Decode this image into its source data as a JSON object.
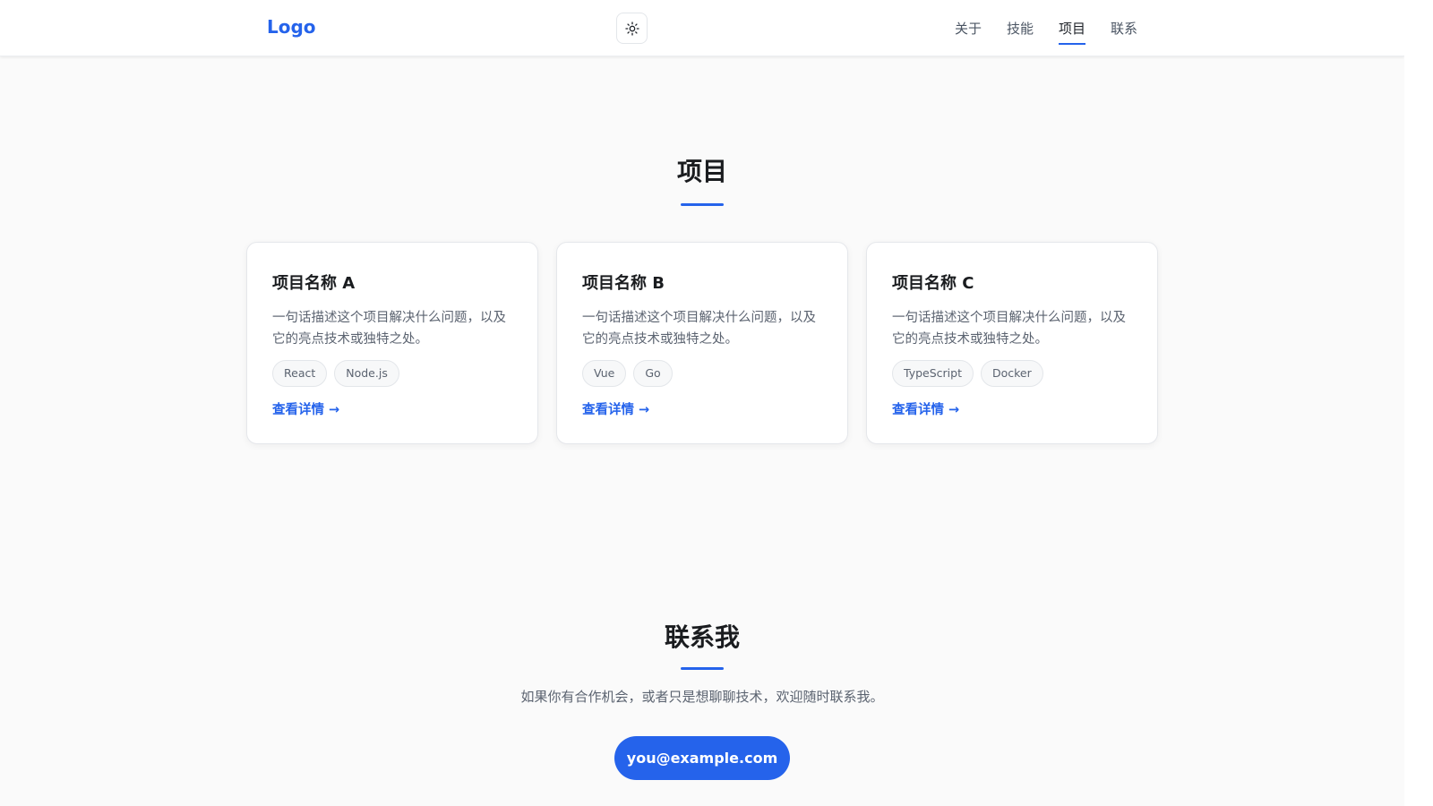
{
  "header": {
    "logo": "Logo",
    "theme_toggle_icon": "sun-icon",
    "nav": [
      {
        "label": "关于"
      },
      {
        "label": "技能"
      },
      {
        "label": "项目",
        "active": true
      },
      {
        "label": "联系"
      }
    ]
  },
  "projects": {
    "title": "项目",
    "cards": [
      {
        "title": "项目名称 A",
        "desc": "一句话描述这个项目解决什么问题，以及它的亮点技术或独特之处。",
        "tags": [
          "React",
          "Node.js"
        ],
        "link": "查看详情 →"
      },
      {
        "title": "项目名称 B",
        "desc": "一句话描述这个项目解决什么问题，以及它的亮点技术或独特之处。",
        "tags": [
          "Vue",
          "Go"
        ],
        "link": "查看详情 →"
      },
      {
        "title": "项目名称 C",
        "desc": "一句话描述这个项目解决什么问题，以及它的亮点技术或独特之处。",
        "tags": [
          "TypeScript",
          "Docker"
        ],
        "link": "查看详情 →"
      }
    ]
  },
  "contact": {
    "title": "联系我",
    "desc": "如果你有合作机会，或者只是想聊聊技术，欢迎随时联系我。",
    "email": "you@example.com"
  },
  "colors": {
    "accent": "#2563eb",
    "background": "#fafafa"
  }
}
